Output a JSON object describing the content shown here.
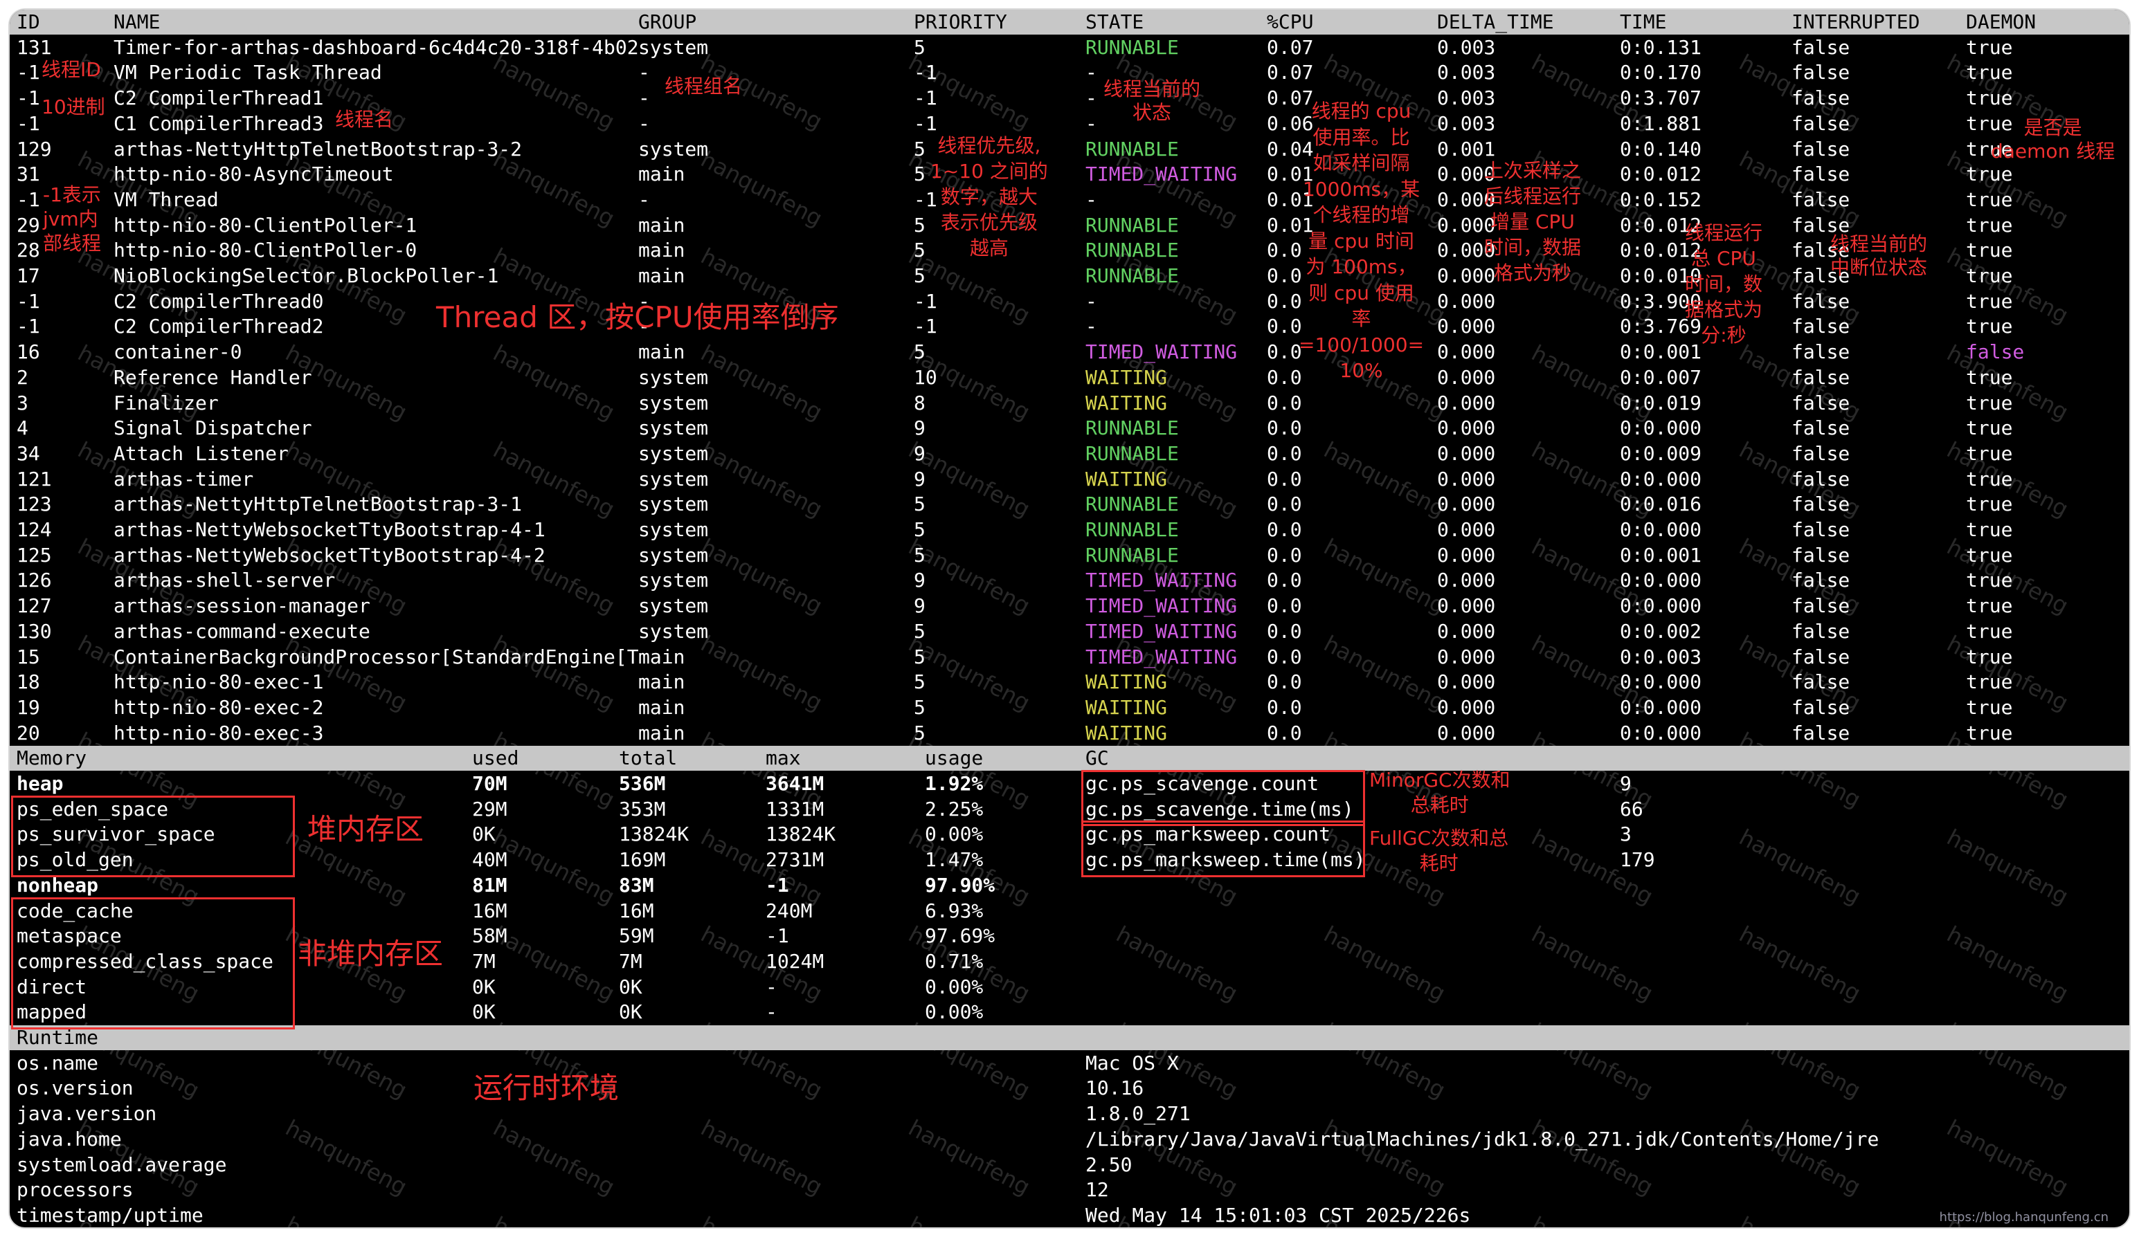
{
  "thread_table": {
    "columns": [
      "ID",
      "NAME",
      "GROUP",
      "PRIORITY",
      "STATE",
      "%CPU",
      "DELTA_TIME",
      "TIME",
      "INTERRUPTED",
      "DAEMON"
    ],
    "rows": [
      [
        "131",
        "Timer-for-arthas-dashboard-6c4d4c20-318f-4b02",
        "system",
        "5",
        "RUNNABLE",
        "0.07",
        "0.003",
        "0:0.131",
        "false",
        "true"
      ],
      [
        "-1",
        "VM Periodic Task Thread",
        "-",
        "-1",
        "-",
        "0.07",
        "0.003",
        "0:0.170",
        "false",
        "true"
      ],
      [
        "-1",
        "C2 CompilerThread1",
        "-",
        "-1",
        "-",
        "0.07",
        "0.003",
        "0:3.707",
        "false",
        "true"
      ],
      [
        "-1",
        "C1 CompilerThread3",
        "-",
        "-1",
        "-",
        "0.06",
        "0.003",
        "0:1.881",
        "false",
        "true"
      ],
      [
        "129",
        "arthas-NettyHttpTelnetBootstrap-3-2",
        "system",
        "5",
        "RUNNABLE",
        "0.04",
        "0.001",
        "0:0.140",
        "false",
        "true"
      ],
      [
        "31",
        "http-nio-80-AsyncTimeout",
        "main",
        "5",
        "TIMED_WAITING",
        "0.01",
        "0.000",
        "0:0.012",
        "false",
        "true"
      ],
      [
        "-1",
        "VM Thread",
        "-",
        "-1",
        "-",
        "0.01",
        "0.000",
        "0:0.152",
        "false",
        "true"
      ],
      [
        "29",
        "http-nio-80-ClientPoller-1",
        "main",
        "5",
        "RUNNABLE",
        "0.01",
        "0.000",
        "0:0.012",
        "false",
        "true"
      ],
      [
        "28",
        "http-nio-80-ClientPoller-0",
        "main",
        "5",
        "RUNNABLE",
        "0.0",
        "0.000",
        "0:0.012",
        "false",
        "true"
      ],
      [
        "17",
        "NioBlockingSelector.BlockPoller-1",
        "main",
        "5",
        "RUNNABLE",
        "0.0",
        "0.000",
        "0:0.010",
        "false",
        "true"
      ],
      [
        "-1",
        "C2 CompilerThread0",
        "-",
        "-1",
        "-",
        "0.0",
        "0.000",
        "0:3.900",
        "false",
        "true"
      ],
      [
        "-1",
        "C2 CompilerThread2",
        "-",
        "-1",
        "-",
        "0.0",
        "0.000",
        "0:3.769",
        "false",
        "true"
      ],
      [
        "16",
        "container-0",
        "main",
        "5",
        "TIMED_WAITING",
        "0.0",
        "0.000",
        "0:0.001",
        "false",
        "false"
      ],
      [
        "2",
        "Reference Handler",
        "system",
        "10",
        "WAITING",
        "0.0",
        "0.000",
        "0:0.007",
        "false",
        "true"
      ],
      [
        "3",
        "Finalizer",
        "system",
        "8",
        "WAITING",
        "0.0",
        "0.000",
        "0:0.019",
        "false",
        "true"
      ],
      [
        "4",
        "Signal Dispatcher",
        "system",
        "9",
        "RUNNABLE",
        "0.0",
        "0.000",
        "0:0.000",
        "false",
        "true"
      ],
      [
        "34",
        "Attach Listener",
        "system",
        "9",
        "RUNNABLE",
        "0.0",
        "0.000",
        "0:0.009",
        "false",
        "true"
      ],
      [
        "121",
        "arthas-timer",
        "system",
        "9",
        "WAITING",
        "0.0",
        "0.000",
        "0:0.000",
        "false",
        "true"
      ],
      [
        "123",
        "arthas-NettyHttpTelnetBootstrap-3-1",
        "system",
        "5",
        "RUNNABLE",
        "0.0",
        "0.000",
        "0:0.016",
        "false",
        "true"
      ],
      [
        "124",
        "arthas-NettyWebsocketTtyBootstrap-4-1",
        "system",
        "5",
        "RUNNABLE",
        "0.0",
        "0.000",
        "0:0.000",
        "false",
        "true"
      ],
      [
        "125",
        "arthas-NettyWebsocketTtyBootstrap-4-2",
        "system",
        "5",
        "RUNNABLE",
        "0.0",
        "0.000",
        "0:0.001",
        "false",
        "true"
      ],
      [
        "126",
        "arthas-shell-server",
        "system",
        "9",
        "TIMED_WAITING",
        "0.0",
        "0.000",
        "0:0.000",
        "false",
        "true"
      ],
      [
        "127",
        "arthas-session-manager",
        "system",
        "9",
        "TIMED_WAITING",
        "0.0",
        "0.000",
        "0:0.000",
        "false",
        "true"
      ],
      [
        "130",
        "arthas-command-execute",
        "system",
        "5",
        "TIMED_WAITING",
        "0.0",
        "0.000",
        "0:0.002",
        "false",
        "true"
      ],
      [
        "15",
        "ContainerBackgroundProcessor[StandardEngine[T",
        "main",
        "5",
        "TIMED_WAITING",
        "0.0",
        "0.000",
        "0:0.003",
        "false",
        "true"
      ],
      [
        "18",
        "http-nio-80-exec-1",
        "main",
        "5",
        "WAITING",
        "0.0",
        "0.000",
        "0:0.000",
        "false",
        "true"
      ],
      [
        "19",
        "http-nio-80-exec-2",
        "main",
        "5",
        "WAITING",
        "0.0",
        "0.000",
        "0:0.000",
        "false",
        "true"
      ],
      [
        "20",
        "http-nio-80-exec-3",
        "main",
        "5",
        "WAITING",
        "0.0",
        "0.000",
        "0:0.000",
        "false",
        "true"
      ]
    ]
  },
  "memory_table": {
    "columns": [
      "Memory",
      "used",
      "total",
      "max",
      "usage"
    ],
    "rows": [
      [
        "heap",
        "70M",
        "536M",
        "3641M",
        "1.92%"
      ],
      [
        "ps_eden_space",
        "29M",
        "353M",
        "1331M",
        "2.25%"
      ],
      [
        "ps_survivor_space",
        "0K",
        "13824K",
        "13824K",
        "0.00%"
      ],
      [
        "ps_old_gen",
        "40M",
        "169M",
        "2731M",
        "1.47%"
      ],
      [
        "nonheap",
        "81M",
        "83M",
        "-1",
        "97.90%"
      ],
      [
        "code_cache",
        "16M",
        "16M",
        "240M",
        "6.93%"
      ],
      [
        "metaspace",
        "58M",
        "59M",
        "-1",
        "97.69%"
      ],
      [
        "compressed_class_space",
        "7M",
        "7M",
        "1024M",
        "0.71%"
      ],
      [
        "direct",
        "0K",
        "0K",
        "-",
        "0.00%"
      ],
      [
        "mapped",
        "0K",
        "0K",
        "-",
        "0.00%"
      ]
    ]
  },
  "gc_table": {
    "title": "GC",
    "rows": [
      [
        "gc.ps_scavenge.count",
        "9"
      ],
      [
        "gc.ps_scavenge.time(ms)",
        "66"
      ],
      [
        "gc.ps_marksweep.count",
        "3"
      ],
      [
        "gc.ps_marksweep.time(ms)",
        "179"
      ]
    ]
  },
  "runtime_table": {
    "title": "Runtime",
    "rows": [
      [
        "os.name",
        "Mac OS X"
      ],
      [
        "os.version",
        "10.16"
      ],
      [
        "java.version",
        "1.8.0_271"
      ],
      [
        "java.home",
        "/Library/Java/JavaVirtualMachines/jdk1.8.0_271.jdk/Contents/Home/jre"
      ],
      [
        "systemload.average",
        "2.50"
      ],
      [
        "processors",
        "12"
      ],
      [
        "timestamp/uptime",
        "Wed May 14 15:01:03 CST 2025/226s"
      ]
    ]
  },
  "state_colors": {
    "RUNNABLE": "#62d162",
    "TIMED_WAITING": "#d05ce0",
    "WAITING": "#d7d44e",
    "-": "#ffffff"
  },
  "annotations": {
    "thread_id": "线程ID",
    "decimal": "10进制",
    "thread_name": "线程名",
    "thread_group": "线程组名",
    "neg_one": "-1表示\njvm内\n部线程",
    "priority": "线程优先级,\n1~10 之间的\n数字，越大\n表示优先级\n越高",
    "state": "线程当前的\n状态",
    "cpu": "线程的 cpu\n使用率。比\n如采样间隔\n1000ms，某\n个线程的增\n量 cpu 时间\n为 100ms，\n则 cpu 使用\n率\n=100/1000=\n10%",
    "delta_time": "上次采样之\n后线程运行\n增量 CPU\n时间，数据\n格式为秒",
    "time": "线程运行\n总 CPU\n时间，数\n据格式为\n分:秒",
    "interrupted": "线程当前的\n中断位状态",
    "daemon": "是否是\ndaemon 线程",
    "thread_area": "Thread 区，按CPU使用率倒序",
    "heap_area": "堆内存区",
    "nonheap_area": "非堆内存区",
    "minor_gc": "MinorGC次数和\n总耗时",
    "full_gc": "FullGC次数和总\n耗时",
    "runtime_area": "运行时环境"
  },
  "watermark": "hanqunfeng",
  "footer_url": "https://blog.hanqunfeng.cn"
}
